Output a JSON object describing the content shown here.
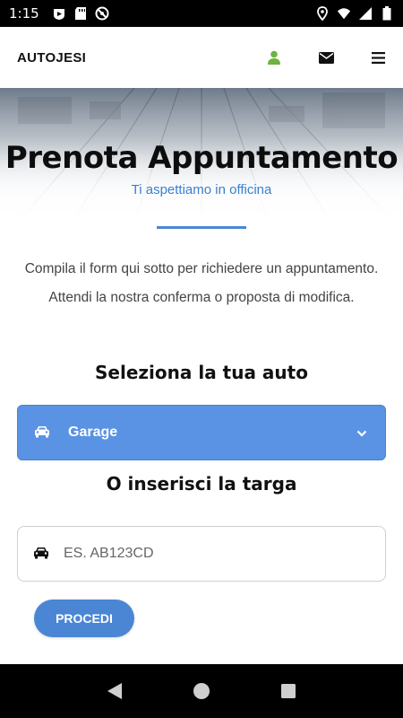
{
  "status_bar": {
    "time": "1:15",
    "icons_left": [
      "play-protect-icon",
      "sd-card-icon",
      "no-disturb-icon"
    ],
    "icons_right": [
      "location-icon",
      "wifi-icon",
      "signal-icon",
      "battery-icon"
    ]
  },
  "navbar": {
    "brand": "AUTOJESI",
    "icons": [
      "user-icon",
      "envelope-icon",
      "menu-icon"
    ],
    "user_icon_color": "#6cb33f"
  },
  "hero": {
    "title": "Prenota Appuntamento",
    "subtitle": "Ti aspettiamo in officina"
  },
  "intro": {
    "text": "Compila il form qui sotto per richiedere un appuntamento. Attendi la nostra conferma o proposta di modifica."
  },
  "select_car": {
    "title": "Seleziona la tua auto",
    "selected": "Garage",
    "color": "#5a93e3"
  },
  "plate": {
    "title": "O inserisci la targa",
    "placeholder": "ES. AB123CD",
    "value": ""
  },
  "submit": {
    "label": "PROCEDI",
    "color": "#4a86d4"
  },
  "system_nav": {
    "buttons": [
      "back-icon",
      "home-icon",
      "recents-icon"
    ]
  }
}
